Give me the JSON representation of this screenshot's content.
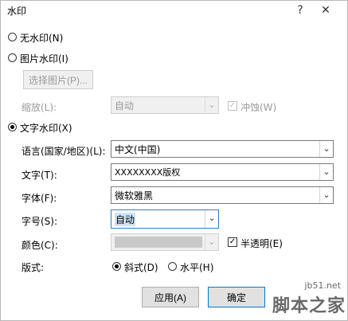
{
  "window": {
    "title": "水印",
    "help_glyph": "?",
    "close_glyph": "✕"
  },
  "options": {
    "no_watermark": "无水印(N)",
    "picture_watermark": "图片水印(I)",
    "text_watermark": "文字水印(X)"
  },
  "picture": {
    "select_button": "选择图片(P)...",
    "scale_label": "缩放(L):",
    "scale_value": "自动",
    "washout_label": "冲蚀(W)"
  },
  "text": {
    "language_label": "语言(国家/地区)(L):",
    "language_value": "中文(中国)",
    "text_label": "文字(T):",
    "text_value": "XXXXXXXX版权",
    "font_label": "字体(F):",
    "font_value": "微软雅黑",
    "size_label": "字号(S):",
    "size_value": "自动",
    "color_label": "颜色(C):",
    "color_value": "",
    "semitransparent_label": "半透明(E)",
    "layout_label": "版式:",
    "diagonal_label": "斜式(D)",
    "horizontal_label": "水平(H)"
  },
  "buttons": {
    "apply": "应用(A)",
    "ok": "确定"
  },
  "overlay": {
    "site": "jb51.net",
    "name": "脚本之家"
  },
  "colors": {
    "color_swatch": "#c8c8c8",
    "selection": "#cce4f7",
    "focus_border": "#2a7fd4"
  }
}
